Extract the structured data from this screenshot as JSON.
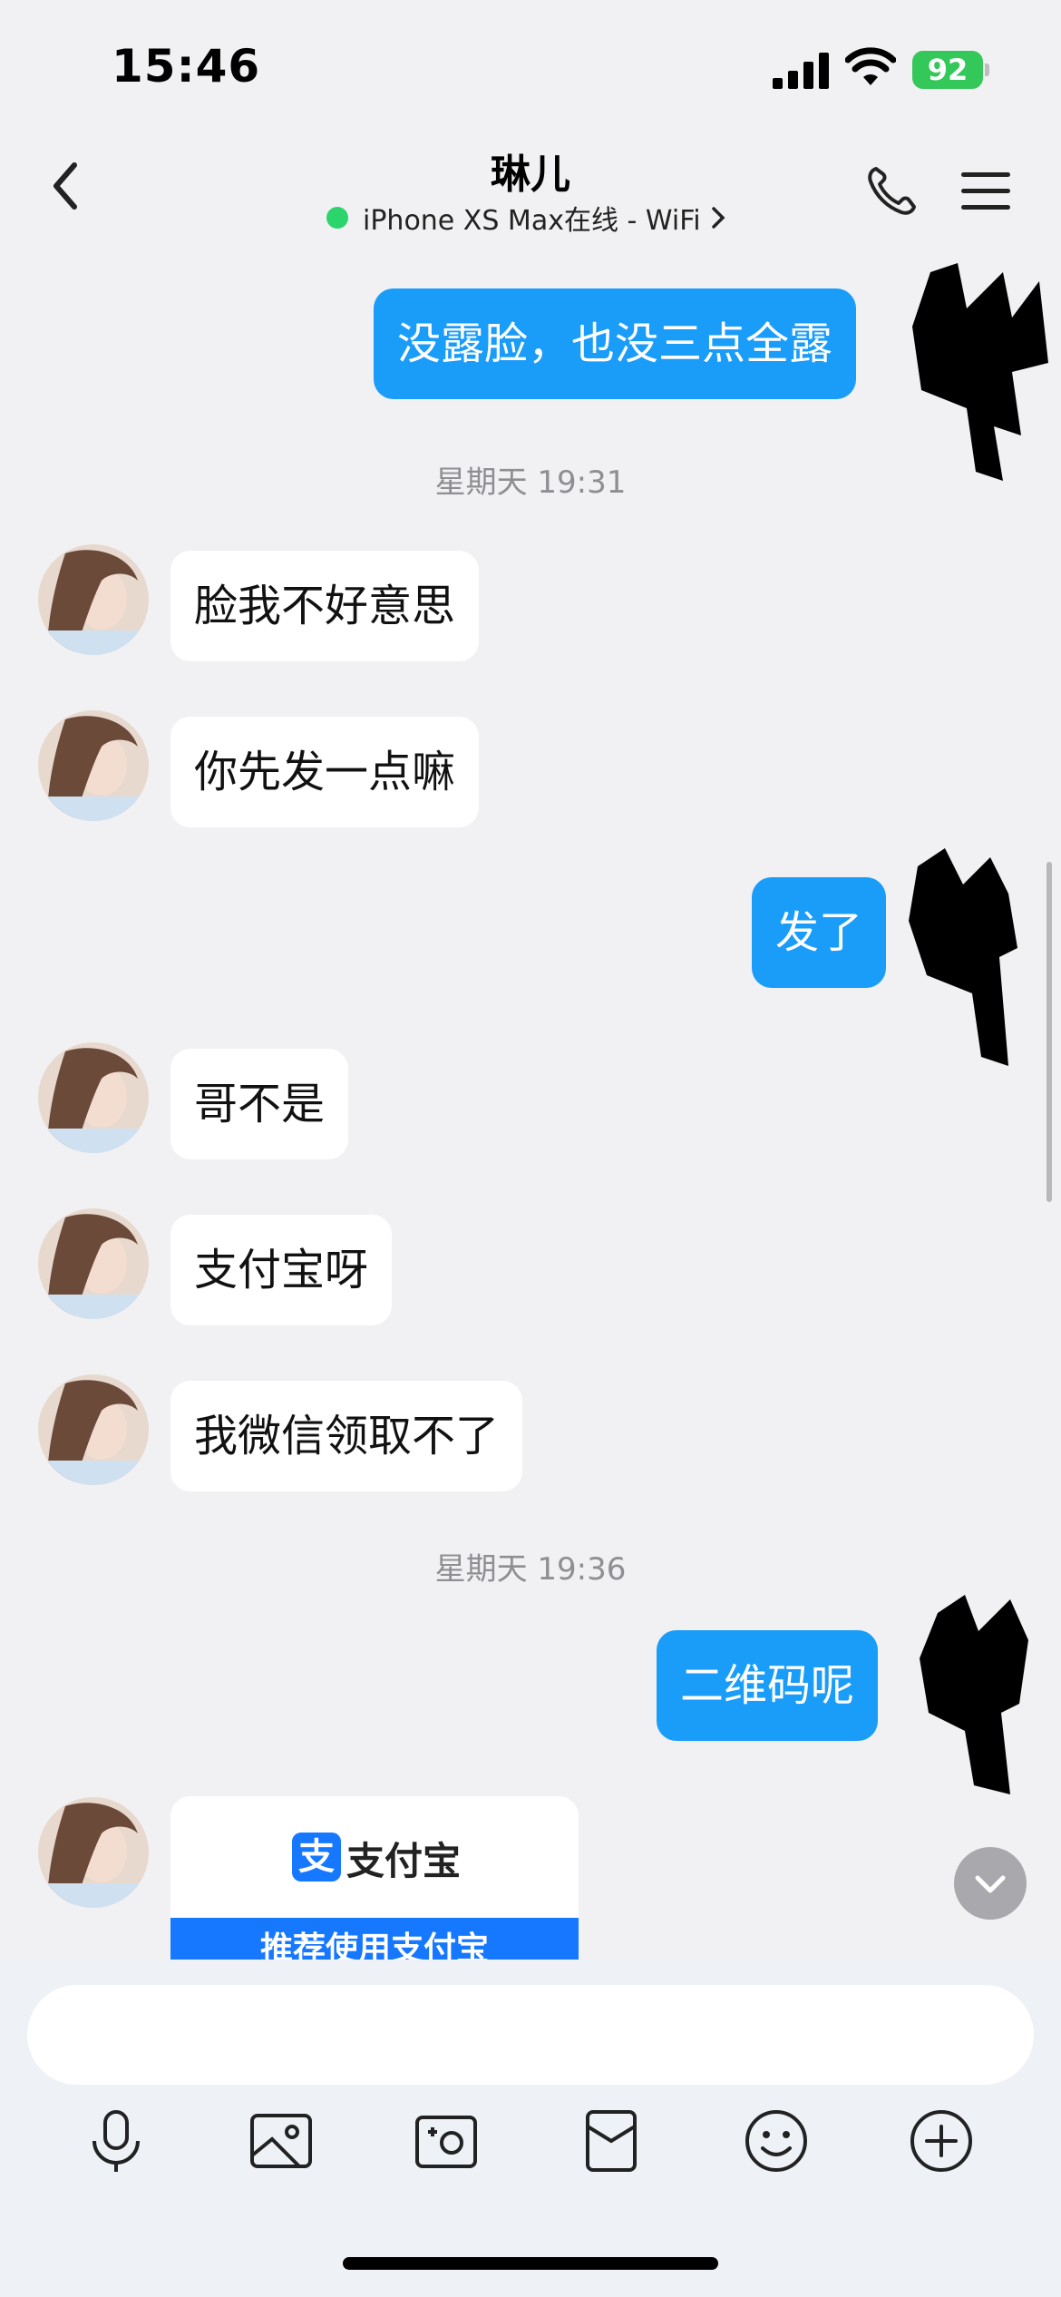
{
  "status_bar": {
    "time": "15:46",
    "battery": "92"
  },
  "header": {
    "title": "琳儿",
    "subtitle": "iPhone XS Max在线 - WiFi",
    "online_color": "#2bd56b"
  },
  "messages": [
    {
      "type": "outgoing",
      "text": "没露脸，也没三点全露"
    },
    {
      "type": "timestamp",
      "text": "星期天 19:31"
    },
    {
      "type": "incoming",
      "text": "脸我不好意思"
    },
    {
      "type": "incoming",
      "text": "你先发一点嘛"
    },
    {
      "type": "outgoing",
      "text": "发了"
    },
    {
      "type": "incoming",
      "text": "哥不是"
    },
    {
      "type": "incoming",
      "text": "支付宝呀"
    },
    {
      "type": "incoming",
      "text": "我微信领取不了"
    },
    {
      "type": "timestamp",
      "text": "星期天 19:36"
    },
    {
      "type": "outgoing",
      "text": "二维码呢"
    }
  ],
  "card": {
    "logo_glyph": "支",
    "brand": "支付宝",
    "banner": "推荐使用支付宝"
  },
  "input": {
    "placeholder": ""
  },
  "toolbar": [
    "microphone-icon",
    "image-icon",
    "camera-icon",
    "red-packet-icon",
    "emoji-icon",
    "plus-icon"
  ],
  "colors": {
    "outgoing_bubble": "#1a9cf9",
    "incoming_bubble": "#ffffff",
    "background": "#f1f1f3",
    "alipay_blue": "#1677ff"
  }
}
